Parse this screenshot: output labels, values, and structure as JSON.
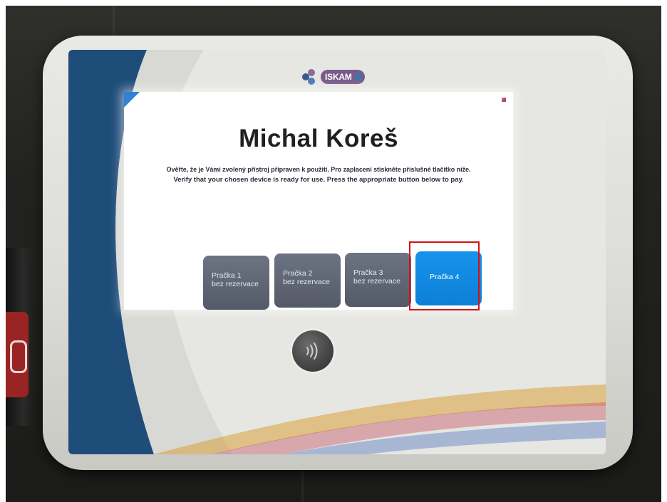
{
  "brand": {
    "logo_text": "ISKAM"
  },
  "screen": {
    "user_name": "Michal Koreš",
    "instruction_cz": "Ověřte, že je Vámi zvolený přístroj připraven k použití. Pro zaplacení stiskněte příslušné tlačítko níže.",
    "instruction_en": "Verify that your chosen device is ready for use. Press the appropriate button below to pay.",
    "machines": [
      {
        "label": "Pračka 1",
        "sub": "bez rezervace",
        "state": "grey"
      },
      {
        "label": "Pračka 2",
        "sub": "bez rezervace",
        "state": "grey"
      },
      {
        "label": "Pračka 3",
        "sub": "bez rezervace",
        "state": "grey"
      },
      {
        "label": "Pračka 4",
        "sub": "",
        "state": "blue"
      }
    ]
  },
  "colors": {
    "button_grey": "#5e6574",
    "button_blue": "#128aea",
    "highlight_red": "#d41212"
  },
  "icons": {
    "contactless": "contactless-icon"
  }
}
